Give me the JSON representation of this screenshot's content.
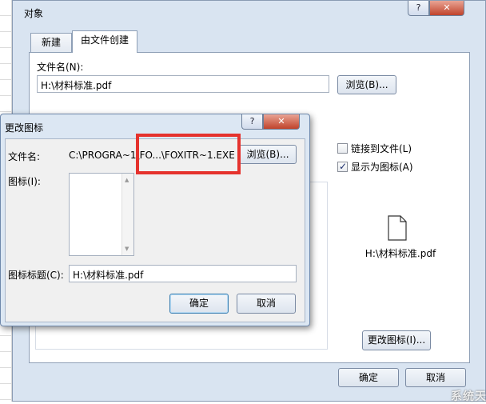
{
  "main_dialog": {
    "title": "对象",
    "help_glyph": "?",
    "close_glyph": "✕",
    "tabs": [
      {
        "label": "新建"
      },
      {
        "label": "由文件创建"
      }
    ],
    "filename_label": "文件名(N):",
    "filename_value": "H:\\材料标准.pdf",
    "browse_label": "浏览(B)...",
    "link_checkbox": {
      "label": "链接到文件(L)",
      "checked": false
    },
    "display_as_icon_checkbox": {
      "label": "显示为图标(A)",
      "checked": true
    },
    "icon_caption": "H:\\材料标准.pdf",
    "icon_name": "document-icon",
    "change_icon_label": "更改图标(I)...",
    "ok_label": "确定",
    "cancel_label": "取消",
    "watermark": "系统天地"
  },
  "change_icon_dialog": {
    "title": "更改图标",
    "help_glyph": "?",
    "close_glyph": "✕",
    "filename_label": "文件名:",
    "filename_value": "C:\\PROGRA~1\\FO...\\FOXITR~1.EXE",
    "browse_label": "浏览(B)...",
    "icon_label": "图标(I):",
    "caption_label": "图标标题(C):",
    "caption_value": "H:\\材料标准.pdf",
    "ok_label": "确定",
    "cancel_label": "取消"
  },
  "colors": {
    "dialog_bg": "#d9e4f1",
    "highlight": "#e5322d",
    "close_button": "#c0432b"
  }
}
